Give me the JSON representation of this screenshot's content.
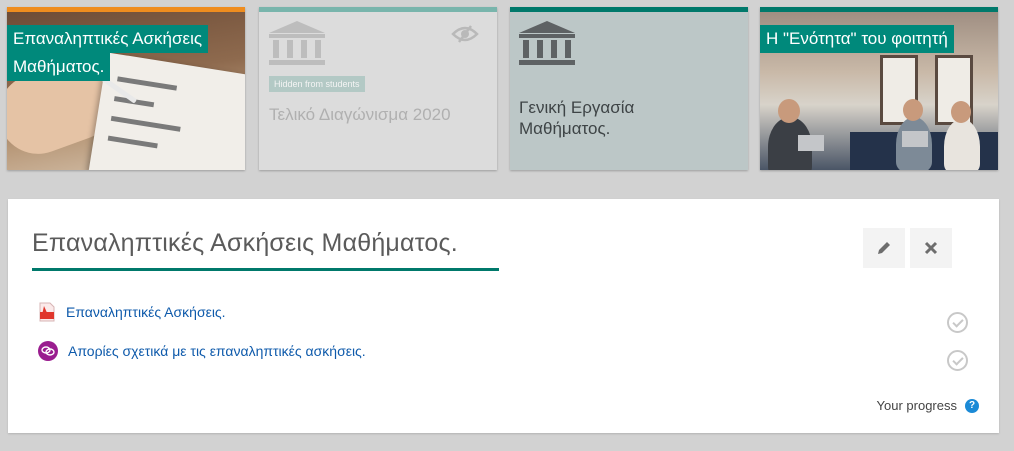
{
  "tiles": [
    {
      "title": "Επαναληπτικές Ασκήσεις Μαθήματος.",
      "topbar_color": "#ef8d1f"
    },
    {
      "title": "Τελικό Διαγώνισμα 2020",
      "badge": "Hidden from students",
      "topbar_color": "#79b5ac",
      "icon": "bank-icon",
      "visibility_icon": "eye-slash-icon"
    },
    {
      "title": "Γενική Εργασία Μαθήματος.",
      "topbar_color": "#00796b",
      "icon": "bank-icon"
    },
    {
      "title": "Η \"Ενότητα\" του φοιτητή",
      "topbar_color": "#00796b"
    }
  ],
  "section": {
    "title": "Επαναληπτικές Ασκήσεις Μαθήματος.",
    "edit_icon": "pencil-icon",
    "close_icon": "close-icon",
    "activities": [
      {
        "label": "Επαναληπτικές Ασκήσεις.",
        "icon": "pdf-icon"
      },
      {
        "label": "Απορίες σχετικά με τις επαναληπτικές ασκήσεις.",
        "icon": "forum-icon"
      }
    ],
    "progress_label": "Your progress",
    "help_symbol": "?"
  },
  "colors": {
    "accent": "#00796b",
    "link": "#0e5aab",
    "orange": "#ef8d1f",
    "help": "#1b8ad6"
  }
}
